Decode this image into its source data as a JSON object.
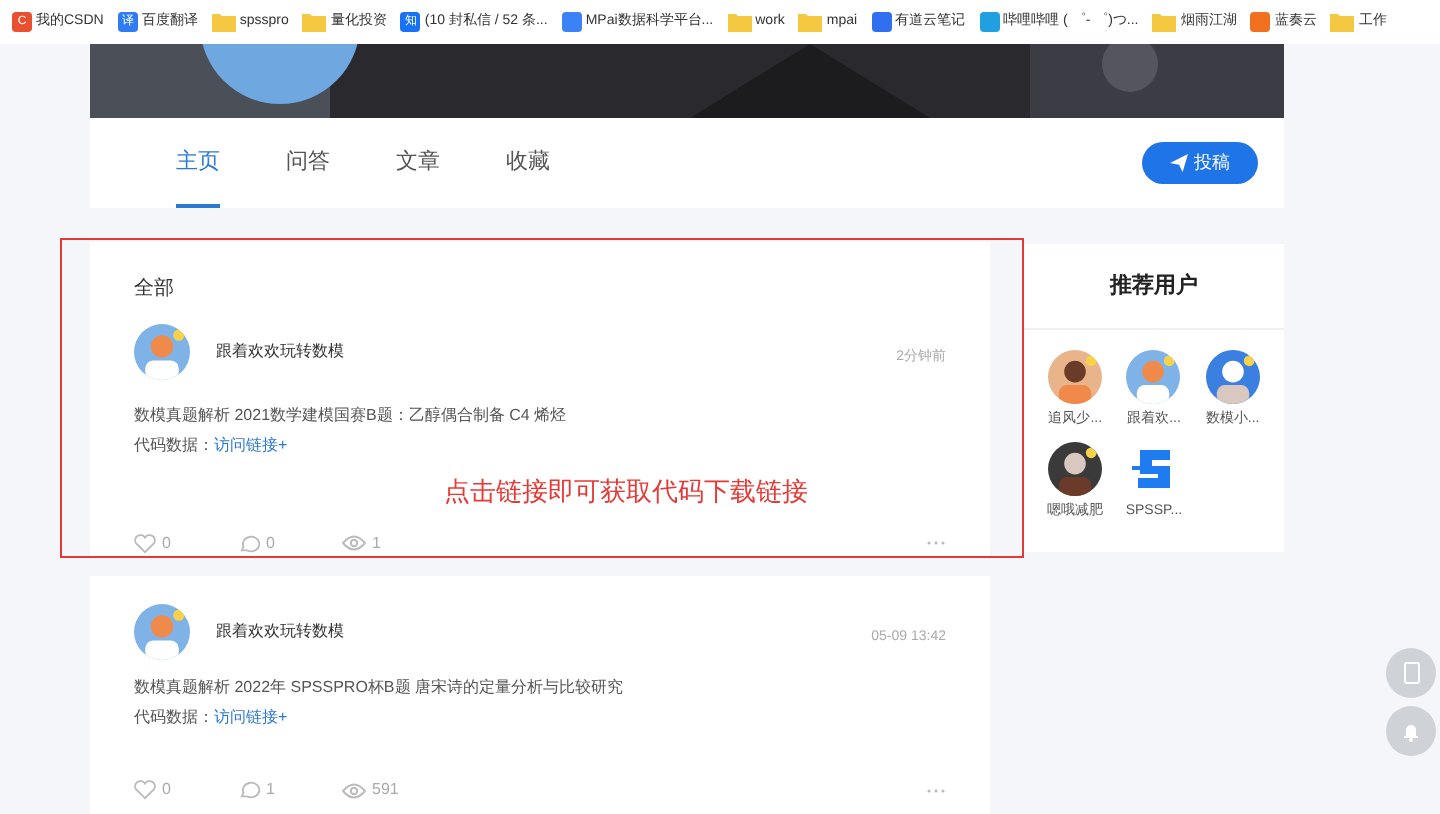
{
  "bookmarks": [
    {
      "label": "我的CSDN",
      "kind": "site",
      "glyph": "C",
      "color": "#e8502f"
    },
    {
      "label": "百度翻译",
      "kind": "site",
      "glyph": "译",
      "color": "#2f7cf6"
    },
    {
      "label": "spsspro",
      "kind": "folder"
    },
    {
      "label": "量化投资",
      "kind": "folder"
    },
    {
      "label": "(10 封私信 / 52 条...",
      "kind": "site",
      "glyph": "知",
      "color": "#1772f6"
    },
    {
      "label": "MPai数据科学平台...",
      "kind": "site",
      "color": "#3b82f6"
    },
    {
      "label": "work",
      "kind": "folder"
    },
    {
      "label": "mpai",
      "kind": "folder"
    },
    {
      "label": "有道云笔记",
      "kind": "site",
      "color": "#2f6ff0"
    },
    {
      "label": "哔哩哔哩 ( ゜- ゜)つ...",
      "kind": "site",
      "color": "#20a0e0"
    },
    {
      "label": "烟雨江湖",
      "kind": "folder"
    },
    {
      "label": "蓝奏云",
      "kind": "site",
      "color": "#f07020"
    },
    {
      "label": "工作",
      "kind": "folder"
    }
  ],
  "tabs": [
    {
      "label": "主页",
      "selected": true
    },
    {
      "label": "问答",
      "selected": false
    },
    {
      "label": "文章",
      "selected": false
    },
    {
      "label": "收藏",
      "selected": false
    }
  ],
  "post_button": "投稿",
  "feed_heading": "全部",
  "posts": [
    {
      "author": "跟着欢欢玩转数模",
      "time": "2分钟前",
      "title": "数模真题解析 2021数学建模国赛B题：乙醇偶合制备 C4 烯烃",
      "code_label": "代码数据：",
      "link": "访问链接+",
      "likes": "0",
      "comments": "0",
      "views": "1",
      "highlighted": true
    },
    {
      "author": "跟着欢欢玩转数模",
      "time": "05-09 13:42",
      "title": "数模真题解析 2022年 SPSSPRO杯B题 唐宋诗的定量分析与比较研究",
      "code_label": "代码数据：",
      "link": "访问链接+",
      "likes": "0",
      "comments": "1",
      "views": "591",
      "highlighted": false
    }
  ],
  "annotation": "点击链接即可获取代码下载链接",
  "sidebar": {
    "title": "推荐用户",
    "users": [
      {
        "name": "追风少...",
        "kind": "picture"
      },
      {
        "name": "跟着欢...",
        "kind": "picture"
      },
      {
        "name": "数模小...",
        "kind": "picture"
      },
      {
        "name": "嗯哦减肥",
        "kind": "picture"
      },
      {
        "name": "SPSSP...",
        "kind": "logo"
      }
    ]
  }
}
